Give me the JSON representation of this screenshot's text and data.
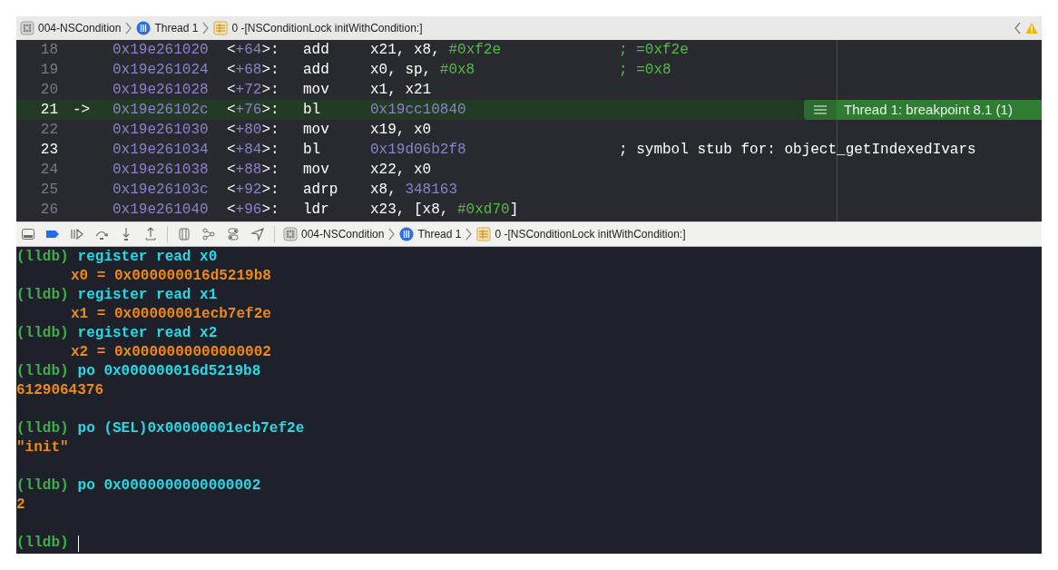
{
  "jump_bar": {
    "crumbs": [
      {
        "kind": "target",
        "label": "004-NSCondition"
      },
      {
        "kind": "thread",
        "label": "Thread 1"
      },
      {
        "kind": "frame",
        "label": "0 -[NSConditionLock initWithCondition:]"
      }
    ]
  },
  "disassembly": {
    "rows": [
      {
        "line": "18",
        "emphasized": false,
        "current": false,
        "address": "0x19e261020",
        "offset_open": "<",
        "offset": "+64",
        "offset_close": ">:",
        "mnemonic": "add",
        "operands": [
          {
            "kind": "plain",
            "text": "x21, x8, "
          },
          {
            "kind": "immediate",
            "text": "#0xf2e"
          }
        ],
        "comment": {
          "kind": "value",
          "text": "; =0xf2e"
        }
      },
      {
        "line": "19",
        "emphasized": false,
        "current": false,
        "address": "0x19e261024",
        "offset_open": "<",
        "offset": "+68",
        "offset_close": ">:",
        "mnemonic": "add",
        "operands": [
          {
            "kind": "plain",
            "text": "x0, sp, "
          },
          {
            "kind": "immediate",
            "text": "#0x8"
          }
        ],
        "comment": {
          "kind": "value",
          "text": "; =0x8"
        }
      },
      {
        "line": "20",
        "emphasized": false,
        "current": false,
        "address": "0x19e261028",
        "offset_open": "<",
        "offset": "+72",
        "offset_close": ">:",
        "mnemonic": "mov",
        "operands": [
          {
            "kind": "plain",
            "text": "x1, x21"
          }
        ]
      },
      {
        "line": "21",
        "emphasized": true,
        "current": true,
        "arrow": "->",
        "address": "0x19e26102c",
        "offset_open": "<",
        "offset": "+76",
        "offset_close": ">:",
        "mnemonic": "bl",
        "operands": [
          {
            "kind": "address",
            "text": "0x19cc10840"
          }
        ],
        "breakpoint": {
          "label": "Thread 1: breakpoint 8.1 (1)"
        }
      },
      {
        "line": "22",
        "emphasized": false,
        "current": false,
        "address": "0x19e261030",
        "offset_open": "<",
        "offset": "+80",
        "offset_close": ">:",
        "mnemonic": "mov",
        "operands": [
          {
            "kind": "plain",
            "text": "x19, x0"
          }
        ]
      },
      {
        "line": "23",
        "emphasized": true,
        "current": false,
        "address": "0x19e261034",
        "offset_open": "<",
        "offset": "+84",
        "offset_close": ">:",
        "mnemonic": "bl",
        "operands": [
          {
            "kind": "address",
            "text": "0x19d06b2f8"
          }
        ],
        "comment": {
          "kind": "symbol",
          "text": "; symbol stub for: object_getIndexedIvars"
        }
      },
      {
        "line": "24",
        "emphasized": false,
        "current": false,
        "address": "0x19e261038",
        "offset_open": "<",
        "offset": "+88",
        "offset_close": ">:",
        "mnemonic": "mov",
        "operands": [
          {
            "kind": "plain",
            "text": "x22, x0"
          }
        ]
      },
      {
        "line": "25",
        "emphasized": false,
        "current": false,
        "address": "0x19e26103c",
        "offset_open": "<",
        "offset": "+92",
        "offset_close": ">:",
        "mnemonic": "adrp",
        "operands": [
          {
            "kind": "plain",
            "text": "x8, "
          },
          {
            "kind": "address",
            "text": "348163"
          }
        ]
      },
      {
        "line": "26",
        "emphasized": false,
        "current": false,
        "address": "0x19e261040",
        "offset_open": "<",
        "offset": "+96",
        "offset_close": ">:",
        "mnemonic": "ldr",
        "operands": [
          {
            "kind": "plain",
            "text": "x23, [x8, "
          },
          {
            "kind": "immediate",
            "text": "#0xd70"
          },
          {
            "kind": "plain",
            "text": "]"
          }
        ]
      }
    ]
  },
  "debug_bar": {
    "breakpoints_active": true,
    "crumbs": [
      {
        "kind": "target",
        "label": "004-NSCondition"
      },
      {
        "kind": "thread",
        "label": "Thread 1"
      },
      {
        "kind": "frame",
        "label": "0 -[NSConditionLock initWithCondition:]"
      }
    ]
  },
  "console": {
    "lines": [
      {
        "kind": "command",
        "prompt": "(lldb)",
        "text": "register read x0"
      },
      {
        "kind": "output",
        "indented": true,
        "text": "x0 = 0x000000016d5219b8"
      },
      {
        "kind": "command",
        "prompt": "(lldb)",
        "text": "register read x1"
      },
      {
        "kind": "output",
        "indented": true,
        "text": "x1 = 0x00000001ecb7ef2e"
      },
      {
        "kind": "command",
        "prompt": "(lldb)",
        "text": "register read x2"
      },
      {
        "kind": "output",
        "indented": true,
        "text": "x2 = 0x0000000000000002"
      },
      {
        "kind": "command",
        "prompt": "(lldb)",
        "text": "po 0x000000016d5219b8"
      },
      {
        "kind": "output",
        "indented": false,
        "text": "6129064376"
      },
      {
        "kind": "blank"
      },
      {
        "kind": "command",
        "prompt": "(lldb)",
        "text": "po (SEL)0x00000001ecb7ef2e"
      },
      {
        "kind": "output",
        "indented": false,
        "text": "\"init\""
      },
      {
        "kind": "blank"
      },
      {
        "kind": "command",
        "prompt": "(lldb)",
        "text": "po 0x0000000000000002"
      },
      {
        "kind": "output",
        "indented": false,
        "text": "2"
      },
      {
        "kind": "blank"
      },
      {
        "kind": "command",
        "prompt": "(lldb)",
        "cursor": true
      }
    ]
  }
}
